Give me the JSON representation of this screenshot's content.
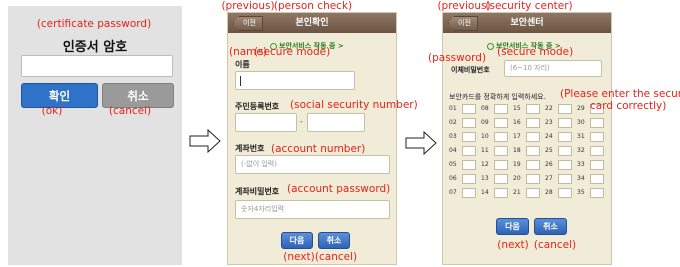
{
  "panel1": {
    "title": "인증서 암호",
    "ok_label": "확인",
    "cancel_label": "취소",
    "annotations": {
      "title": "(certificate password)",
      "ok": "(ok)",
      "cancel": "(cancel)"
    }
  },
  "panel2": {
    "back_label": "이전",
    "nav_title": "본인확인",
    "secure_text": "보안서비스 작동 중 >",
    "name_label": "이름",
    "ssn_label": "주민등록번호",
    "ssn_separator": "-",
    "account_label": "계좌번호",
    "account_placeholder": "(-없이 입력)",
    "account_pw_label": "계좌비밀번호",
    "account_pw_placeholder": "숫자4자리입력",
    "next_label": "다음",
    "cancel_label": "취소",
    "annotations": {
      "previous": "(previous)",
      "title": "(person check)",
      "name": "(name)",
      "secure": "(secure mode)",
      "ssn": "(social security number)",
      "account": "(account number)",
      "account_pw": "(account password)",
      "next": "(next)",
      "cancel": "(cancel)"
    }
  },
  "panel3": {
    "back_label": "이전",
    "nav_title": "보안센터",
    "secure_text": "보안서비스 작동 중 >",
    "pw_label": "이체비밀번호",
    "pw_placeholder": "(6~10 자리)",
    "card_instruction": "보안카드를 정확하게 입력하세요.",
    "grid_numbers": [
      [
        "01",
        "08",
        "15",
        "22",
        "29"
      ],
      [
        "02",
        "09",
        "16",
        "23",
        "30"
      ],
      [
        "03",
        "10",
        "17",
        "24",
        "31"
      ],
      [
        "04",
        "11",
        "18",
        "25",
        "32"
      ],
      [
        "05",
        "12",
        "19",
        "26",
        "33"
      ],
      [
        "06",
        "13",
        "20",
        "27",
        "34"
      ],
      [
        "07",
        "14",
        "21",
        "28",
        "35"
      ]
    ],
    "next_label": "다음",
    "cancel_label": "취소",
    "annotations": {
      "previous": "(previous)",
      "title": "(security center)",
      "secure": "(secure mode)",
      "password": "(password)",
      "instruction_line1": "(Please enter the security",
      "instruction_line2": "card correctly)",
      "next": "(next)",
      "cancel": "(cancel)"
    }
  }
}
